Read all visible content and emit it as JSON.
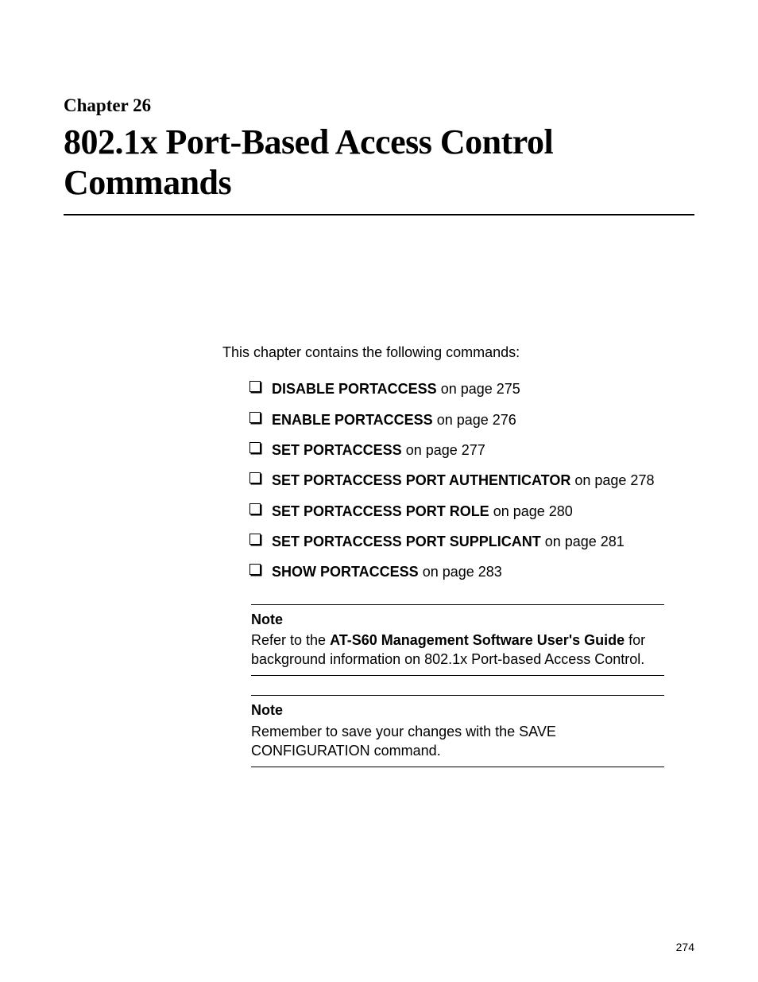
{
  "chapter": {
    "label": "Chapter 26",
    "title": "802.1x Port-Based Access Control Commands"
  },
  "intro": "This chapter contains the following commands:",
  "commands": [
    {
      "name": "DISABLE PORTACCESS",
      "suffix": " on page 275"
    },
    {
      "name": "ENABLE PORTACCESS",
      "suffix": " on page 276"
    },
    {
      "name": "SET PORTACCESS",
      "suffix": " on page 277"
    },
    {
      "name": "SET PORTACCESS PORT AUTHENTICATOR",
      "suffix": " on page 278"
    },
    {
      "name": "SET PORTACCESS PORT ROLE",
      "suffix": " on page 280"
    },
    {
      "name": "SET PORTACCESS PORT SUPPLICANT",
      "suffix": " on page 281"
    },
    {
      "name": "SHOW PORTACCESS",
      "suffix": " on page 283"
    }
  ],
  "notes": [
    {
      "heading": "Note",
      "pre": "Refer to the ",
      "bold": "AT-S60 Management Software User's Guide",
      "post": " for background information on 802.1x Port-based Access Control."
    },
    {
      "heading": "Note",
      "pre": "Remember to save your changes with the SAVE CONFIGURATION command.",
      "bold": "",
      "post": ""
    }
  ],
  "page_number": "274"
}
